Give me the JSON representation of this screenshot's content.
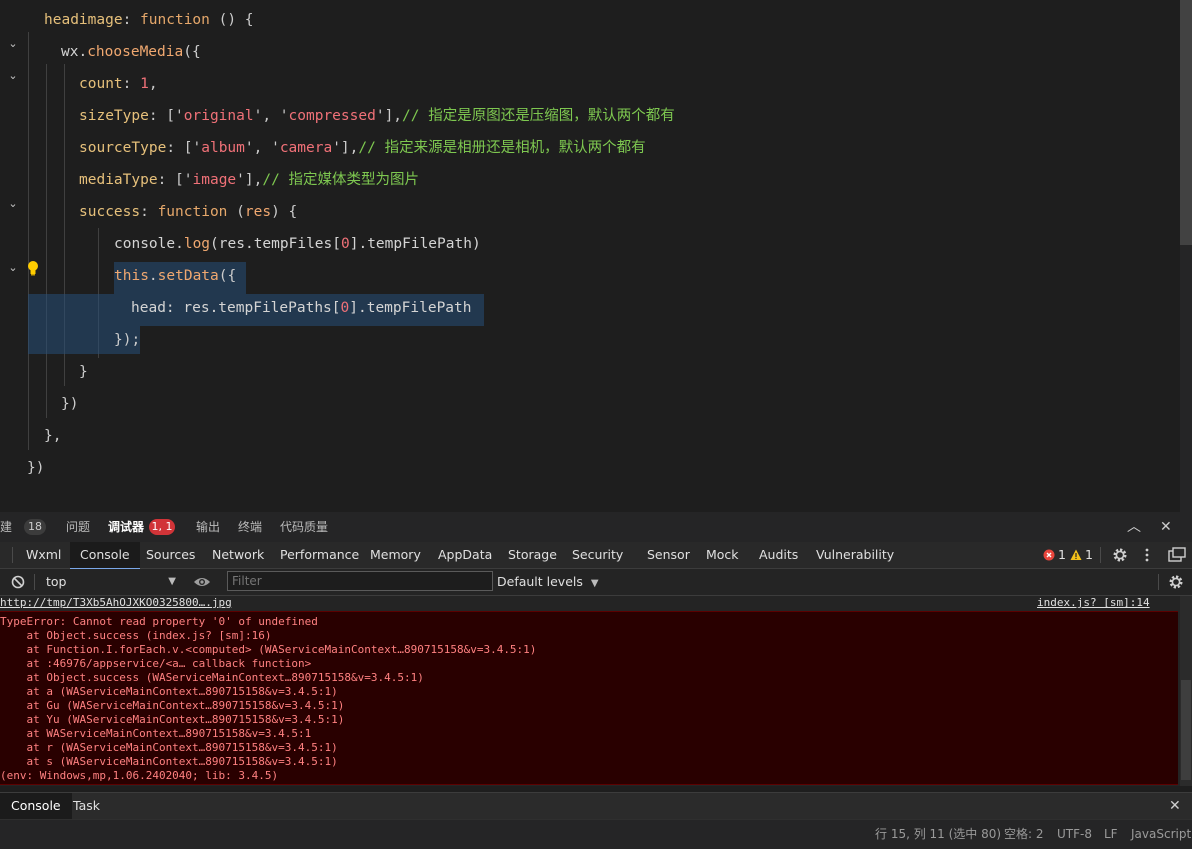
{
  "editor": {
    "lines": [
      {
        "tokens": [
          {
            "t": "headimage",
            "c": "key"
          },
          {
            "t": ": ",
            "c": "punc"
          },
          {
            "t": "function",
            "c": "kw"
          },
          {
            "t": " () {",
            "c": "punc"
          }
        ]
      },
      {
        "tokens": [
          {
            "t": "wx",
            "c": "plain"
          },
          {
            "t": ".",
            "c": "punc"
          },
          {
            "t": "chooseMedia",
            "c": "call"
          },
          {
            "t": "({",
            "c": "punc"
          }
        ]
      },
      {
        "tokens": [
          {
            "t": "count",
            "c": "key"
          },
          {
            "t": ": ",
            "c": "punc"
          },
          {
            "t": "1",
            "c": "num"
          },
          {
            "t": ",",
            "c": "punc"
          }
        ]
      },
      {
        "tokens": [
          {
            "t": "sizeType",
            "c": "key"
          },
          {
            "t": ": ['",
            "c": "punc"
          },
          {
            "t": "original",
            "c": "str"
          },
          {
            "t": "', '",
            "c": "punc"
          },
          {
            "t": "compressed",
            "c": "str"
          },
          {
            "t": "'],",
            "c": "punc"
          },
          {
            "t": "// 指定是原图还是压缩图，默认两个都有",
            "c": "cm"
          }
        ]
      },
      {
        "tokens": [
          {
            "t": "sourceType",
            "c": "key"
          },
          {
            "t": ": ['",
            "c": "punc"
          },
          {
            "t": "album",
            "c": "str"
          },
          {
            "t": "', '",
            "c": "punc"
          },
          {
            "t": "camera",
            "c": "str"
          },
          {
            "t": "'],",
            "c": "punc"
          },
          {
            "t": "// 指定来源是相册还是相机，默认两个都有",
            "c": "cm"
          }
        ]
      },
      {
        "tokens": [
          {
            "t": "mediaType",
            "c": "key"
          },
          {
            "t": ": ['",
            "c": "punc"
          },
          {
            "t": "image",
            "c": "str"
          },
          {
            "t": "'],",
            "c": "punc"
          },
          {
            "t": "// 指定媒体类型为图片",
            "c": "cm"
          }
        ]
      },
      {
        "tokens": [
          {
            "t": "success",
            "c": "key"
          },
          {
            "t": ": ",
            "c": "punc"
          },
          {
            "t": "function",
            "c": "kw"
          },
          {
            "t": " (",
            "c": "punc"
          },
          {
            "t": "res",
            "c": "call"
          },
          {
            "t": ") {",
            "c": "punc"
          }
        ]
      },
      {
        "tokens": [
          {
            "t": "console",
            "c": "plain"
          },
          {
            "t": ".",
            "c": "punc"
          },
          {
            "t": "log",
            "c": "call"
          },
          {
            "t": "(res.tempFiles[",
            "c": "plain"
          },
          {
            "t": "0",
            "c": "num"
          },
          {
            "t": "].tempFilePath)",
            "c": "plain"
          }
        ]
      },
      {
        "tokens": [
          {
            "t": "this",
            "c": "call"
          },
          {
            "t": ".",
            "c": "punc"
          },
          {
            "t": "setData",
            "c": "call"
          },
          {
            "t": "({",
            "c": "punc"
          }
        ]
      },
      {
        "tokens": [
          {
            "t": "head",
            "c": "plain"
          },
          {
            "t": ": res.tempFilePaths[",
            "c": "plain"
          },
          {
            "t": "0",
            "c": "num"
          },
          {
            "t": "].tempFilePath",
            "c": "plain"
          }
        ]
      },
      {
        "tokens": [
          {
            "t": "});",
            "c": "punc"
          }
        ]
      },
      {
        "tokens": [
          {
            "t": "}",
            "c": "punc"
          }
        ]
      },
      {
        "tokens": [
          {
            "t": "})",
            "c": "punc"
          }
        ]
      },
      {
        "tokens": [
          {
            "t": "},",
            "c": "punc"
          }
        ]
      },
      {
        "tokens": [
          {
            "t": "})",
            "c": "punc"
          }
        ]
      }
    ]
  },
  "panel": {
    "tabs": [
      {
        "label": "构建",
        "badge": "18"
      },
      {
        "label": "问题"
      },
      {
        "label": "调试器",
        "badge": "1, 1",
        "active": true
      },
      {
        "label": "输出"
      },
      {
        "label": "终端"
      },
      {
        "label": "代码质量"
      }
    ],
    "collapse_glyph": "︿",
    "close_glyph": "✕"
  },
  "devtools": {
    "tabs": [
      "Wxml",
      "Console",
      "Sources",
      "Network",
      "Performance",
      "Memory",
      "AppData",
      "Storage",
      "Security",
      "Sensor",
      "Mock",
      "Audits",
      "Vulnerability"
    ],
    "active_tab": "Console",
    "error_count": "1",
    "warning_count": "1"
  },
  "toolbar": {
    "context": "top",
    "filter_placeholder": "Filter",
    "levels": "Default levels"
  },
  "console": {
    "log_line": "http://tmp/T3Xb5AhOJXKO0325800….jpg",
    "log_source": "index.js? [sm]:14",
    "error_lines": [
      "TypeError: Cannot read property '0' of undefined",
      "    at Object.success (index.js? [sm]:16)",
      "    at Function.I.forEach.v.<computed> (WAServiceMainContext…890715158&v=3.4.5:1)",
      "    at :46976/appservice/<a… callback function>",
      "    at Object.success (WAServiceMainContext…890715158&v=3.4.5:1)",
      "    at a (WAServiceMainContext…890715158&v=3.4.5:1)",
      "    at Gu (WAServiceMainContext…890715158&v=3.4.5:1)",
      "    at Yu (WAServiceMainContext…890715158&v=3.4.5:1)",
      "    at WAServiceMainContext…890715158&v=3.4.5:1",
      "    at r (WAServiceMainContext…890715158&v=3.4.5:1)",
      "    at s (WAServiceMainContext…890715158&v=3.4.5:1)",
      "(env: Windows,mp,1.06.2402040; lib: 3.4.5)"
    ]
  },
  "drawer": {
    "tabs": [
      "Console",
      "Task"
    ],
    "active": "Console"
  },
  "status": {
    "position": "行 15, 列 11 (选中 80)",
    "indent": "空格: 2",
    "encoding": "UTF-8",
    "eol": "LF",
    "language": "JavaScript"
  },
  "colors": {
    "error_bg": "#290000",
    "error_text": "#ff8080",
    "badge_red": "#d13438",
    "accent": "#7aa7e8"
  }
}
